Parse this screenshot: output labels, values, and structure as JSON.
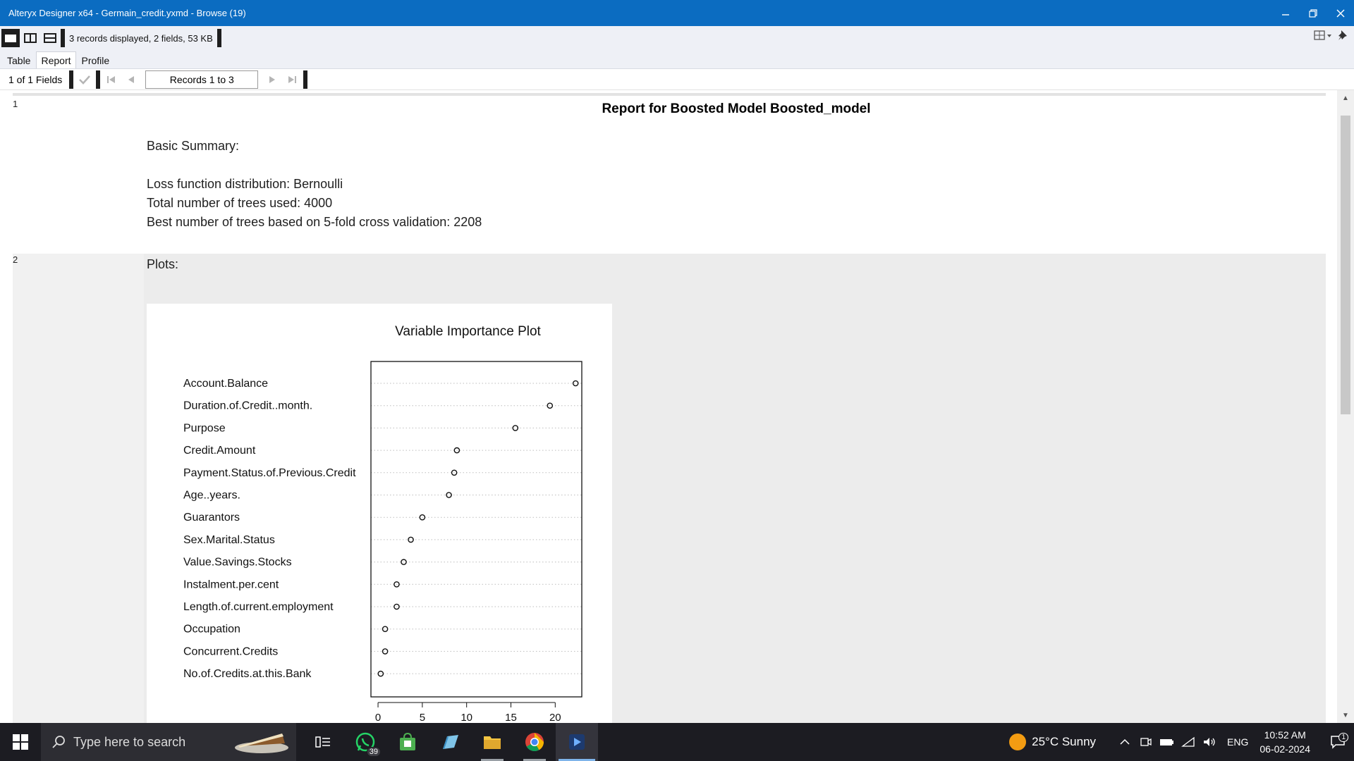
{
  "window": {
    "title": "Alteryx Designer x64 - Germain_credit.yxmd - Browse (19)",
    "controls": {
      "minimize": "–",
      "restore": "❐",
      "close": "✕"
    }
  },
  "toolbar": {
    "status": "3 records displayed, 2 fields, 53 KB",
    "icons": [
      "single-view-icon",
      "split-vertical-icon",
      "split-horizontal-icon"
    ],
    "right_icons": [
      "layout-dropdown-icon",
      "pin-icon"
    ]
  },
  "tabs": [
    {
      "label": "Table",
      "active": false
    },
    {
      "label": "Report",
      "active": true
    },
    {
      "label": "Profile",
      "active": false
    }
  ],
  "nav": {
    "fields": "1 of 1 Fields",
    "records": "Records 1 to 3"
  },
  "rows": [
    {
      "num": "1",
      "title": "Report for Boosted Model Boosted_model",
      "summary_heading": "Basic Summary:",
      "lines": [
        "Loss function distribution: Bernoulli",
        "Total number of trees used: 4000",
        "Best number of trees based on 5-fold cross validation: 2208"
      ]
    },
    {
      "num": "2",
      "heading": "Plots:"
    }
  ],
  "chart_data": {
    "type": "scatter",
    "title": "Variable Importance Plot",
    "categories": [
      "Account.Balance",
      "Duration.of.Credit..month.",
      "Purpose",
      "Credit.Amount",
      "Payment.Status.of.Previous.Credit",
      "Age..years.",
      "Guarantors",
      "Sex.Marital.Status",
      "Value.Savings.Stocks",
      "Instalment.per.cent",
      "Length.of.current.employment",
      "Occupation",
      "Concurrent.Credits",
      "No.of.Credits.at.this.Bank"
    ],
    "values": [
      22.3,
      19.4,
      15.5,
      8.9,
      8.6,
      8.0,
      5.0,
      3.7,
      2.9,
      2.1,
      2.1,
      0.8,
      0.8,
      0.3
    ],
    "xticks": [
      0,
      5,
      10,
      15,
      20
    ],
    "xlim": [
      -0.8,
      23.0
    ],
    "xlabel": "",
    "ylabel": "",
    "grid": "dotted horizontal"
  },
  "taskbar": {
    "search_placeholder": "Type here to search",
    "whatsapp_badge": "39",
    "weather": "25°C  Sunny",
    "lang": "ENG",
    "time": "10:52 AM",
    "date": "06-02-2024",
    "notifications": "1"
  }
}
